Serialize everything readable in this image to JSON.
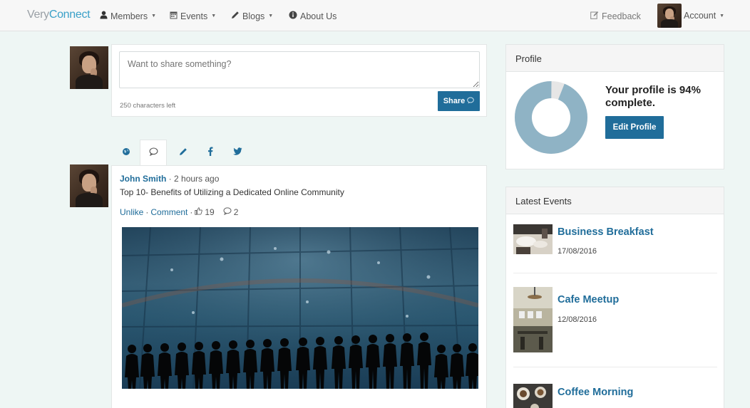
{
  "nav": {
    "brand_part1": "Very",
    "brand_part2": "Connect",
    "items": [
      {
        "label": "Members",
        "icon": "user-icon"
      },
      {
        "label": "Events",
        "icon": "calendar-icon"
      },
      {
        "label": "Blogs",
        "icon": "pencil-icon"
      },
      {
        "label": "About Us",
        "icon": "info-icon"
      }
    ],
    "feedback_label": "Feedback",
    "account_label": "Account"
  },
  "composer": {
    "placeholder": "Want to share something?",
    "chars_left": "250 characters left",
    "share_label": "Share"
  },
  "tabs": [
    {
      "icon": "globe-icon",
      "glyph": "●"
    },
    {
      "icon": "comment-icon",
      "glyph": "◯"
    },
    {
      "icon": "pencil-icon",
      "glyph": "✎"
    },
    {
      "icon": "facebook-icon",
      "glyph": "f"
    },
    {
      "icon": "twitter-icon",
      "glyph": "🐦"
    }
  ],
  "post": {
    "author": "John Smith",
    "time": " · 2 hours ago",
    "title": "Top 10- Benefits of Utilizing a Dedicated Online Community",
    "unlike_label": "Unlike",
    "separator": " · ",
    "comment_label": "Comment",
    "like_count": "19",
    "comment_count": "2"
  },
  "profile": {
    "header": "Profile",
    "completion_text": "Your profile is 94% complete.",
    "completion_fraction": 0.94,
    "edit_label": "Edit Profile",
    "colors": {
      "filled": "#8fb3c5",
      "empty": "#e6e6e6"
    }
  },
  "events": {
    "header": "Latest Events",
    "items": [
      {
        "title": "Business Breakfast",
        "date": "17/08/2016",
        "icon": "breakfast-thumbnail"
      },
      {
        "title": "Cafe Meetup",
        "date": "12/08/2016",
        "icon": "cafe-thumbnail"
      },
      {
        "title": "Coffee Morning",
        "date": "",
        "icon": "coffee-thumbnail"
      }
    ]
  },
  "colors": {
    "accent": "#206d9a",
    "page_bg": "#eef6f4"
  }
}
